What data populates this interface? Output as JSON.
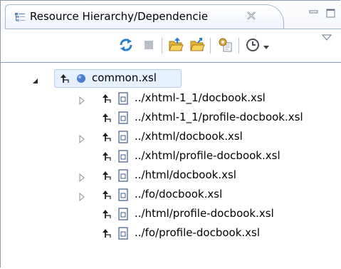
{
  "view": {
    "title": "Resource Hierarchy/Dependencie",
    "close_icon": "close-icon",
    "minimize_icon": "minimize-icon",
    "maximize_icon": "maximize-icon"
  },
  "toolbar": {
    "items": [
      {
        "name": "refresh-button",
        "icon": "refresh-icon"
      },
      {
        "name": "stop-button",
        "icon": "stop-icon"
      },
      {
        "name": "show-hierarchy-button",
        "icon": "open-folder-icon"
      },
      {
        "name": "show-dependencies-button",
        "icon": "open-folder-arrow-icon"
      },
      {
        "name": "configure-button",
        "icon": "gear-document-icon"
      },
      {
        "name": "history-menu-button",
        "icon": "clock-icon"
      },
      {
        "name": "view-menu-button",
        "icon": "chevron-down-icon"
      }
    ]
  },
  "tree": {
    "root": {
      "label": "common.xsl",
      "expanded": true,
      "selected": true
    },
    "children": [
      {
        "label": "../xhtml-1_1/docbook.xsl",
        "expandable": true
      },
      {
        "label": "../xhtml-1_1/profile-docbook.xsl",
        "expandable": false
      },
      {
        "label": "../xhtml/docbook.xsl",
        "expandable": true
      },
      {
        "label": "../xhtml/profile-docbook.xsl",
        "expandable": false
      },
      {
        "label": "../html/docbook.xsl",
        "expandable": true
      },
      {
        "label": "../fo/docbook.xsl",
        "expandable": true
      },
      {
        "label": "../html/profile-docbook.xsl",
        "expandable": false
      },
      {
        "label": "../fo/profile-docbook.xsl",
        "expandable": false
      }
    ]
  },
  "colors": {
    "border": "#8c9bb0",
    "tab_border": "#a6b7cf",
    "selection_bg": "#e6f0fd",
    "root_dot": "#4a7fd0"
  }
}
